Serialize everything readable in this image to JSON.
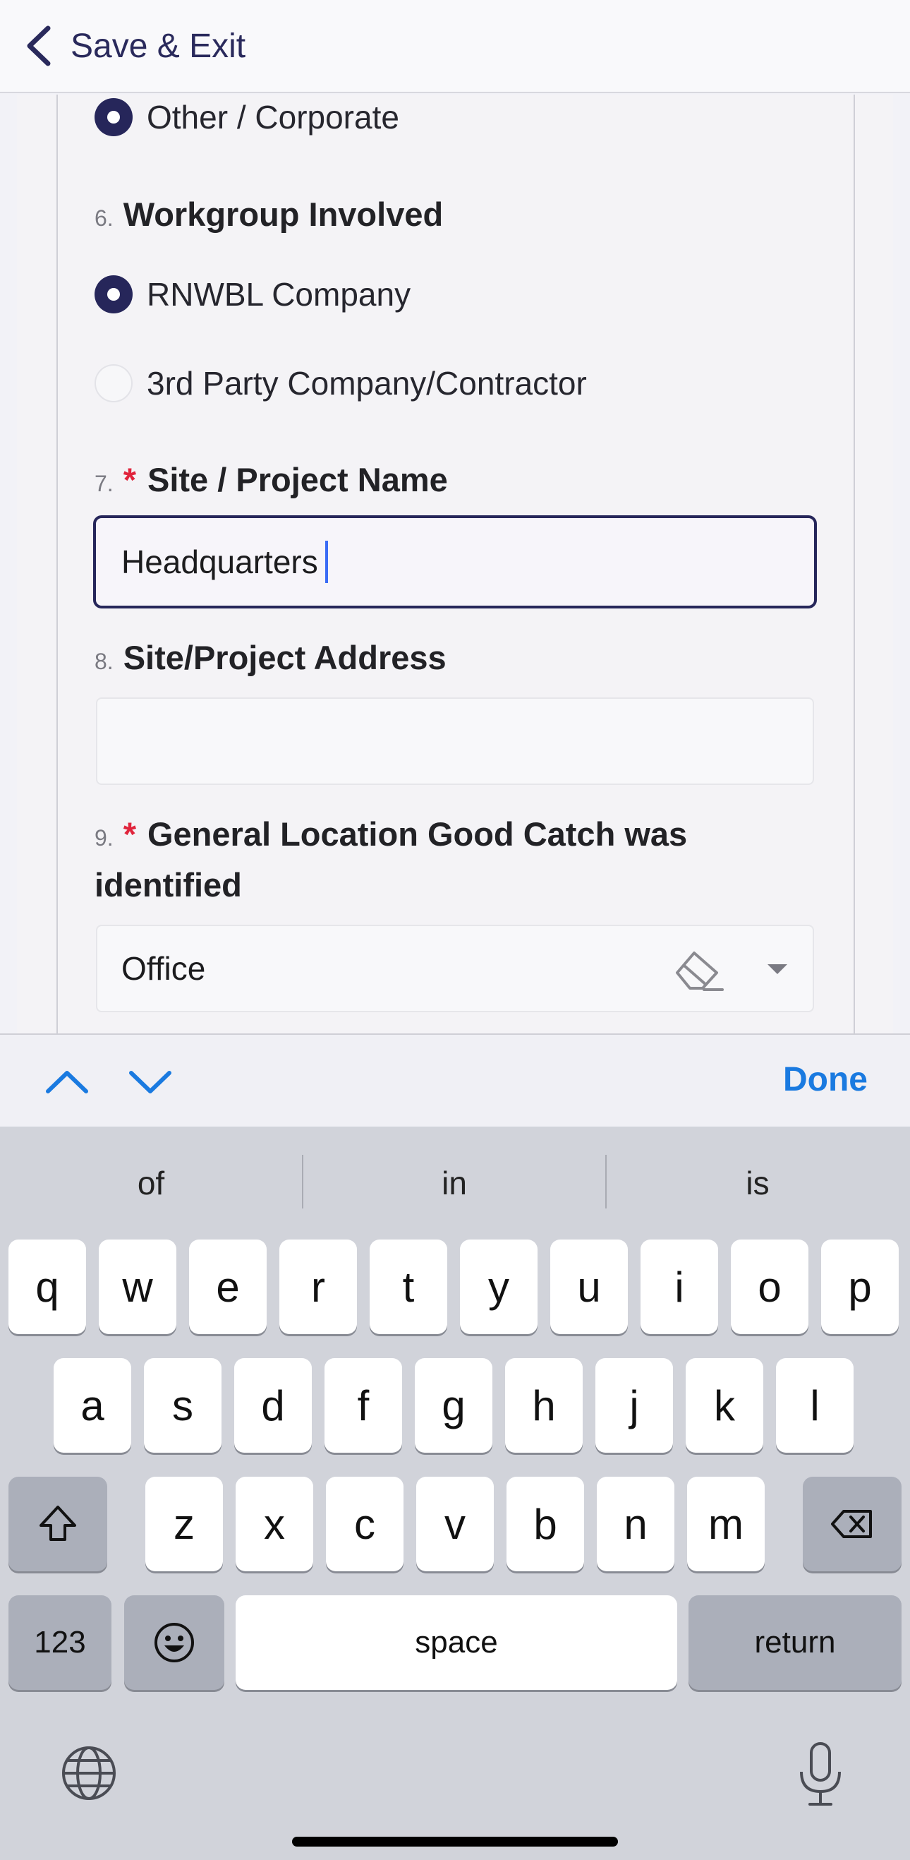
{
  "header": {
    "back_label": "Save & Exit"
  },
  "form": {
    "q5_option_selected": "Other / Corporate",
    "q6": {
      "number": "6.",
      "label": "Workgroup Involved",
      "options": [
        "RNWBL Company",
        "3rd Party Company/Contractor"
      ],
      "selected_index": 0
    },
    "q7": {
      "number": "7.",
      "required_mark": "*",
      "label": "Site / Project Name",
      "value": "Headquarters"
    },
    "q8": {
      "number": "8.",
      "label": "Site/Project Address",
      "value": ""
    },
    "q9": {
      "number": "9.",
      "required_mark": "*",
      "label_line1": "General Location Good Catch was",
      "label_line2": "identified",
      "value": "Office"
    }
  },
  "accessory": {
    "done_label": "Done"
  },
  "keyboard": {
    "suggestions": [
      "of",
      "in",
      "is"
    ],
    "row1": [
      "q",
      "w",
      "e",
      "r",
      "t",
      "y",
      "u",
      "i",
      "o",
      "p"
    ],
    "row2": [
      "a",
      "s",
      "d",
      "f",
      "g",
      "h",
      "j",
      "k",
      "l"
    ],
    "row3": [
      "z",
      "x",
      "c",
      "v",
      "b",
      "n",
      "m"
    ],
    "numbers_label": "123",
    "space_label": "space",
    "return_label": "return"
  },
  "colors": {
    "accent": "#26265a",
    "required": "#e0243c",
    "link": "#1a7ae0",
    "caret": "#3b6cf5"
  },
  "icons": [
    "chevron-left-icon",
    "chevron-up-icon",
    "chevron-down-icon",
    "eraser-icon",
    "dropdown-caret-icon",
    "shift-icon",
    "delete-icon",
    "emoji-icon",
    "globe-icon",
    "microphone-icon"
  ]
}
